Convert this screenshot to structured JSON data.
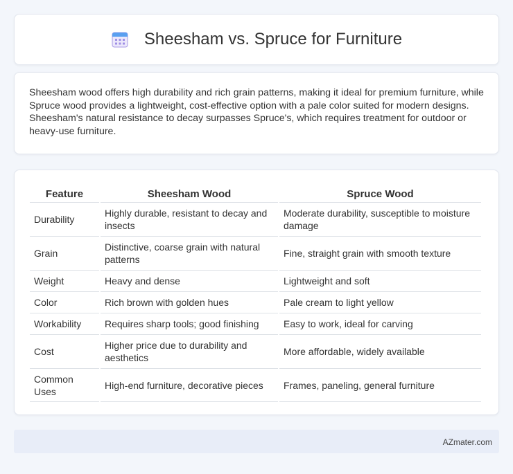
{
  "header": {
    "title": "Sheesham vs. Spruce for Furniture",
    "icon": "calendar-icon"
  },
  "intro": {
    "text": "Sheesham wood offers high durability and rich grain patterns, making it ideal for premium furniture, while Spruce wood provides a lightweight, cost-effective option with a pale color suited for modern designs. Sheesham's natural resistance to decay surpasses Spruce's, which requires treatment for outdoor or heavy-use furniture."
  },
  "table": {
    "headers": [
      "Feature",
      "Sheesham Wood",
      "Spruce Wood"
    ],
    "rows": [
      [
        "Durability",
        "Highly durable, resistant to decay and insects",
        "Moderate durability, susceptible to moisture damage"
      ],
      [
        "Grain",
        "Distinctive, coarse grain with natural patterns",
        "Fine, straight grain with smooth texture"
      ],
      [
        "Weight",
        "Heavy and dense",
        "Lightweight and soft"
      ],
      [
        "Color",
        "Rich brown with golden hues",
        "Pale cream to light yellow"
      ],
      [
        "Workability",
        "Requires sharp tools; good finishing",
        "Easy to work, ideal for carving"
      ],
      [
        "Cost",
        "Higher price due to durability and aesthetics",
        "More affordable, widely available"
      ],
      [
        "Common Uses",
        "High-end furniture, decorative pieces",
        "Frames, paneling, general furniture"
      ]
    ]
  },
  "footer": {
    "text": "AZmater.com"
  },
  "colors": {
    "page_bg": "#f3f6fb",
    "card_bg": "#ffffff",
    "footer_bg": "#e8edf8",
    "icon_accent": "#8f7fe0"
  }
}
